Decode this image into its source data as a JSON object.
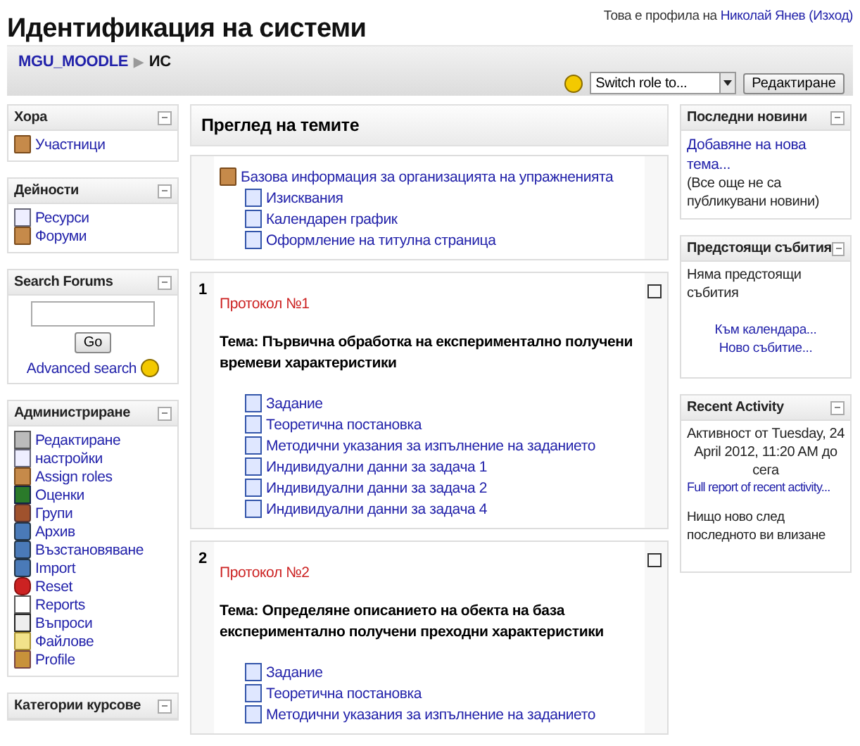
{
  "header": {
    "title": "Идентификация на системи",
    "login_prefix": "Това е профила на",
    "user": "Николай Янев",
    "logout": "(Изход)"
  },
  "breadcrumb": {
    "home": "MGU_MOODLE",
    "separator": "▶",
    "current": "ИС"
  },
  "role_select": {
    "value": "Switch role to..."
  },
  "edit_button": "Редактиране",
  "left_blocks": [
    {
      "title": "Хора",
      "kind": "links",
      "items": [
        {
          "label": "Участници",
          "kind": "people"
        }
      ]
    },
    {
      "title": "Дейности",
      "kind": "links",
      "items": [
        {
          "label": "Ресурси",
          "kind": "resource"
        },
        {
          "label": "Форуми",
          "kind": "people"
        }
      ]
    },
    {
      "title": "Search Forums",
      "kind": "search",
      "button": "Go",
      "link": "Advanced search"
    },
    {
      "title": "Администриране",
      "kind": "links",
      "items": [
        {
          "label": "Редактиране",
          "kind": "edit"
        },
        {
          "label": "настройки",
          "kind": "resource"
        },
        {
          "label": "Assign roles",
          "kind": "people"
        },
        {
          "label": "Оценки",
          "kind": "grades"
        },
        {
          "label": "Групи",
          "kind": "groups"
        },
        {
          "label": "Архив",
          "kind": "box"
        },
        {
          "label": "Възстановяване",
          "kind": "box"
        },
        {
          "label": "Import",
          "kind": "box"
        },
        {
          "label": "Reset",
          "kind": "reset"
        },
        {
          "label": "Reports",
          "kind": "chart"
        },
        {
          "label": "Въпроси",
          "kind": "questions"
        },
        {
          "label": "Файлове",
          "kind": "folder"
        },
        {
          "label": "Profile",
          "kind": "profile"
        }
      ]
    },
    {
      "title": "Категории курсове",
      "kind": "links"
    }
  ],
  "main": {
    "title": "Преглед на темите",
    "sections": [
      {
        "items": [
          {
            "label": "Базова информация за организацията на упражненията",
            "kind": "forum",
            "indent": false
          },
          {
            "label": "Изисквания",
            "kind": "doc",
            "indent": true
          },
          {
            "label": "Календарен график",
            "kind": "doc",
            "indent": true
          },
          {
            "label": "Оформление на титулна страница",
            "kind": "doc",
            "indent": true
          }
        ]
      },
      {
        "number": "1",
        "name": "Протокол №1",
        "topic": "Тема: Първична обработка на експериментално получени времеви характеристики",
        "items": [
          {
            "label": "Задание",
            "kind": "doc",
            "indent": true
          },
          {
            "label": "Теоретична постановка",
            "kind": "doc",
            "indent": true
          },
          {
            "label": "Методични указания за изпълнение на заданието",
            "kind": "doc",
            "indent": true
          },
          {
            "label": "Индивидуални данни за задача 1",
            "kind": "doc",
            "indent": true
          },
          {
            "label": "Индивидуални данни за задача 2",
            "kind": "doc",
            "indent": true
          },
          {
            "label": "Индивидуални данни за задача 4",
            "kind": "doc",
            "indent": true
          }
        ]
      },
      {
        "number": "2",
        "name": "Протокол №2",
        "topic": "Тема: Определяне описанието на обекта на база експериментално получени преходни характеристики",
        "items": [
          {
            "label": "Задание",
            "kind": "doc",
            "indent": true
          },
          {
            "label": "Теоретична постановка",
            "kind": "doc",
            "indent": true
          },
          {
            "label": "Методични указания за изпълнение на заданието",
            "kind": "doc",
            "indent": true
          }
        ]
      }
    ]
  },
  "right_blocks": [
    {
      "title": "Последни новини",
      "kind": "news",
      "link": "Добавяне на нова тема...",
      "text": "(Все още не са публикувани новини)"
    },
    {
      "title": "Предстоящи събития",
      "kind": "events",
      "text": "Няма предстоящи събития",
      "links": [
        "Към календара...",
        "Ново събитие..."
      ]
    },
    {
      "title": "Recent Activity",
      "kind": "activity",
      "text": "Активност от Tuesday, 24 April 2012, 11:20 AM до сега",
      "link": "Full report of recent activity...",
      "note": "Нищо ново след последното ви влизане"
    }
  ]
}
